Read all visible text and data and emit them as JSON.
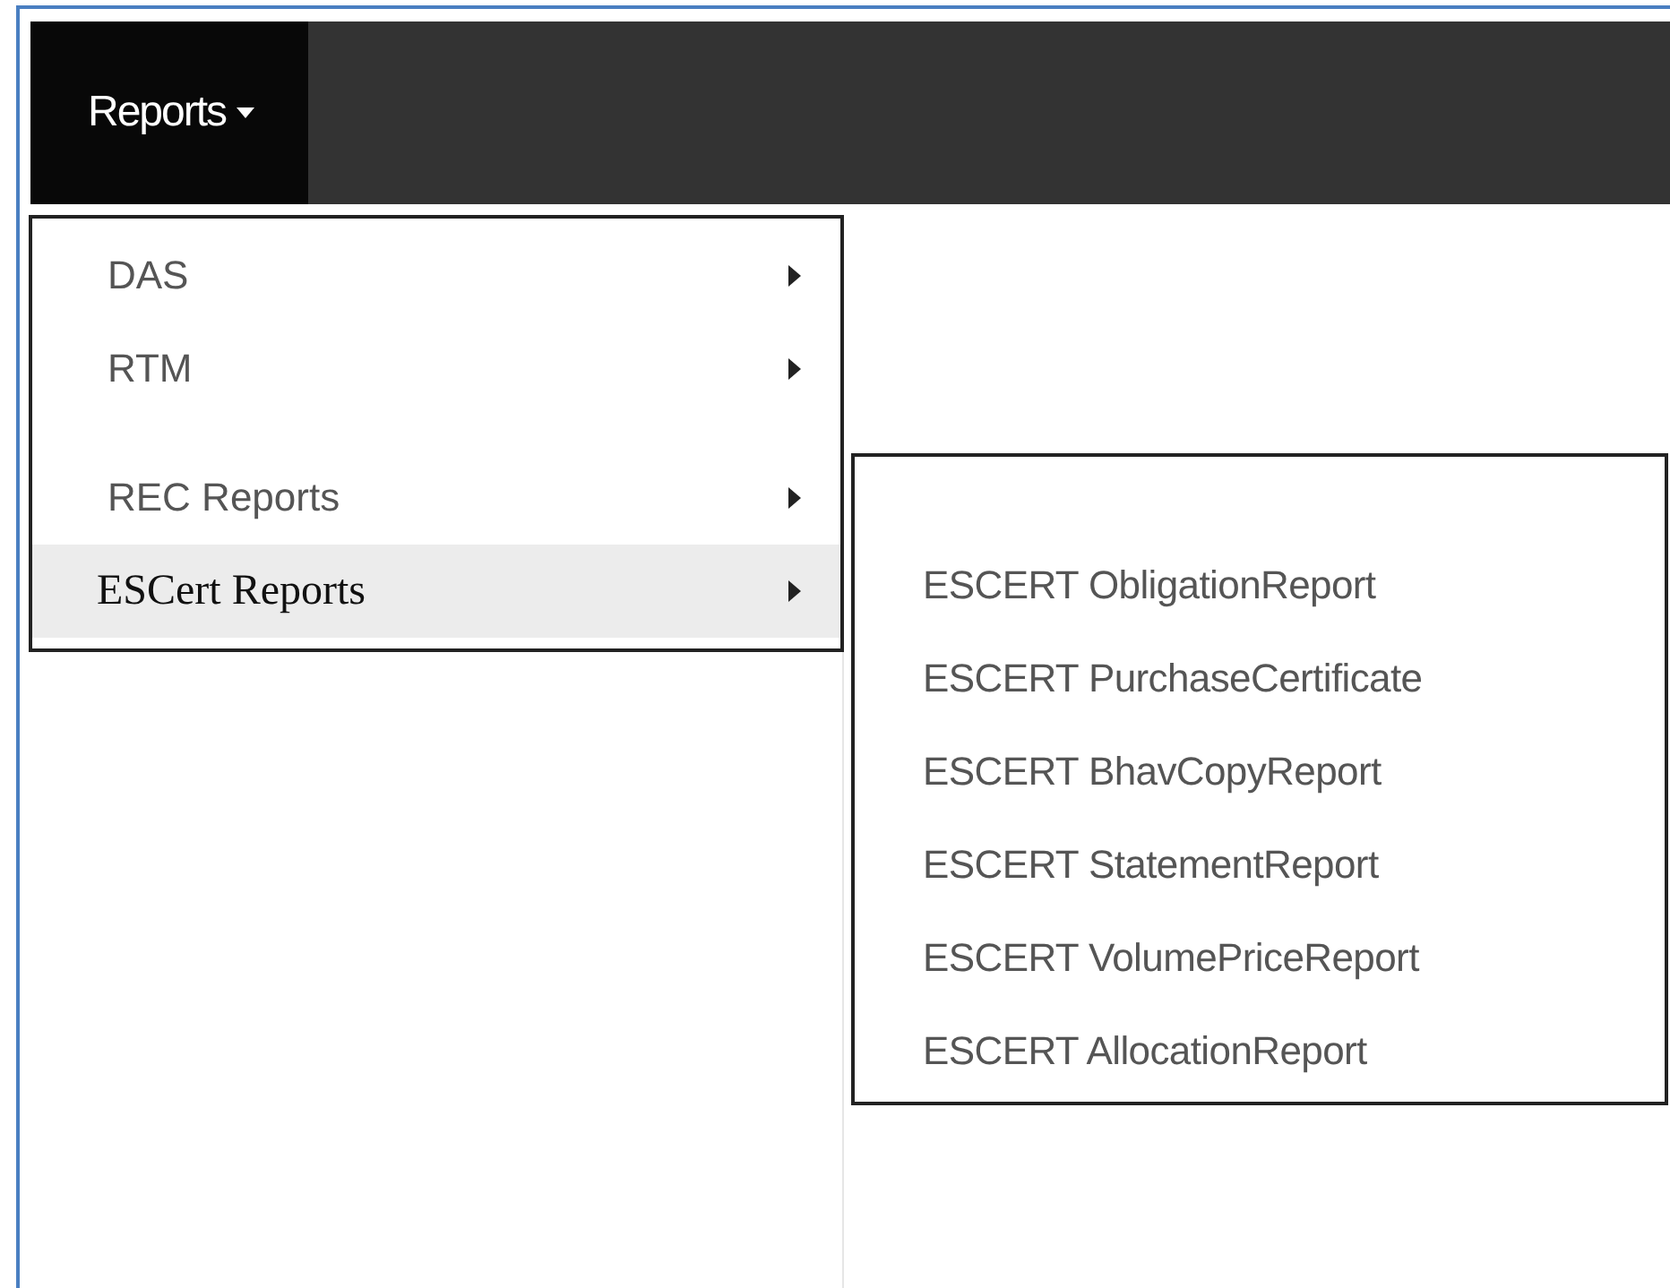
{
  "navbar": {
    "menu_button": {
      "label": "Reports",
      "expanded": true
    }
  },
  "menu": {
    "items": [
      {
        "label": "DAS",
        "selected": false
      },
      {
        "label": "RTM",
        "selected": false
      },
      {
        "label": "REC Reports",
        "selected": false
      },
      {
        "label": "ESCert Reports",
        "selected": true
      }
    ]
  },
  "submenu": {
    "items": [
      {
        "label": "ESCERT ObligationReport"
      },
      {
        "label": "ESCERT PurchaseCertificate"
      },
      {
        "label": "ESCERT BhavCopyReport"
      },
      {
        "label": "ESCERT StatementReport"
      },
      {
        "label": "ESCERT VolumePriceReport"
      },
      {
        "label": "ESCERT AllocationReport"
      }
    ]
  }
}
